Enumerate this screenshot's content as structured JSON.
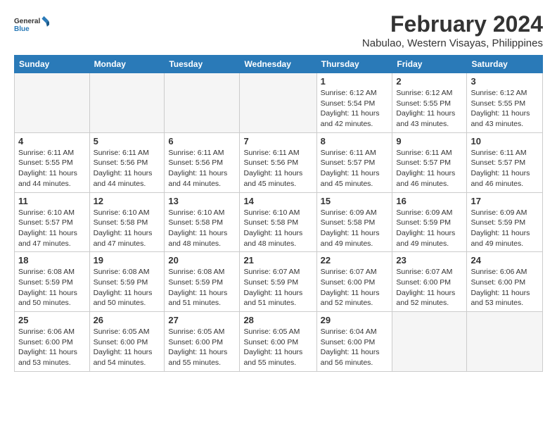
{
  "logo": {
    "text_general": "General",
    "text_blue": "Blue"
  },
  "title": "February 2024",
  "subtitle": "Nabulao, Western Visayas, Philippines",
  "days_of_week": [
    "Sunday",
    "Monday",
    "Tuesday",
    "Wednesday",
    "Thursday",
    "Friday",
    "Saturday"
  ],
  "weeks": [
    [
      {
        "day": "",
        "info": ""
      },
      {
        "day": "",
        "info": ""
      },
      {
        "day": "",
        "info": ""
      },
      {
        "day": "",
        "info": ""
      },
      {
        "day": "1",
        "info": "Sunrise: 6:12 AM\nSunset: 5:54 PM\nDaylight: 11 hours\nand 42 minutes."
      },
      {
        "day": "2",
        "info": "Sunrise: 6:12 AM\nSunset: 5:55 PM\nDaylight: 11 hours\nand 43 minutes."
      },
      {
        "day": "3",
        "info": "Sunrise: 6:12 AM\nSunset: 5:55 PM\nDaylight: 11 hours\nand 43 minutes."
      }
    ],
    [
      {
        "day": "4",
        "info": "Sunrise: 6:11 AM\nSunset: 5:55 PM\nDaylight: 11 hours\nand 44 minutes."
      },
      {
        "day": "5",
        "info": "Sunrise: 6:11 AM\nSunset: 5:56 PM\nDaylight: 11 hours\nand 44 minutes."
      },
      {
        "day": "6",
        "info": "Sunrise: 6:11 AM\nSunset: 5:56 PM\nDaylight: 11 hours\nand 44 minutes."
      },
      {
        "day": "7",
        "info": "Sunrise: 6:11 AM\nSunset: 5:56 PM\nDaylight: 11 hours\nand 45 minutes."
      },
      {
        "day": "8",
        "info": "Sunrise: 6:11 AM\nSunset: 5:57 PM\nDaylight: 11 hours\nand 45 minutes."
      },
      {
        "day": "9",
        "info": "Sunrise: 6:11 AM\nSunset: 5:57 PM\nDaylight: 11 hours\nand 46 minutes."
      },
      {
        "day": "10",
        "info": "Sunrise: 6:11 AM\nSunset: 5:57 PM\nDaylight: 11 hours\nand 46 minutes."
      }
    ],
    [
      {
        "day": "11",
        "info": "Sunrise: 6:10 AM\nSunset: 5:57 PM\nDaylight: 11 hours\nand 47 minutes."
      },
      {
        "day": "12",
        "info": "Sunrise: 6:10 AM\nSunset: 5:58 PM\nDaylight: 11 hours\nand 47 minutes."
      },
      {
        "day": "13",
        "info": "Sunrise: 6:10 AM\nSunset: 5:58 PM\nDaylight: 11 hours\nand 48 minutes."
      },
      {
        "day": "14",
        "info": "Sunrise: 6:10 AM\nSunset: 5:58 PM\nDaylight: 11 hours\nand 48 minutes."
      },
      {
        "day": "15",
        "info": "Sunrise: 6:09 AM\nSunset: 5:58 PM\nDaylight: 11 hours\nand 49 minutes."
      },
      {
        "day": "16",
        "info": "Sunrise: 6:09 AM\nSunset: 5:59 PM\nDaylight: 11 hours\nand 49 minutes."
      },
      {
        "day": "17",
        "info": "Sunrise: 6:09 AM\nSunset: 5:59 PM\nDaylight: 11 hours\nand 49 minutes."
      }
    ],
    [
      {
        "day": "18",
        "info": "Sunrise: 6:08 AM\nSunset: 5:59 PM\nDaylight: 11 hours\nand 50 minutes."
      },
      {
        "day": "19",
        "info": "Sunrise: 6:08 AM\nSunset: 5:59 PM\nDaylight: 11 hours\nand 50 minutes."
      },
      {
        "day": "20",
        "info": "Sunrise: 6:08 AM\nSunset: 5:59 PM\nDaylight: 11 hours\nand 51 minutes."
      },
      {
        "day": "21",
        "info": "Sunrise: 6:07 AM\nSunset: 5:59 PM\nDaylight: 11 hours\nand 51 minutes."
      },
      {
        "day": "22",
        "info": "Sunrise: 6:07 AM\nSunset: 6:00 PM\nDaylight: 11 hours\nand 52 minutes."
      },
      {
        "day": "23",
        "info": "Sunrise: 6:07 AM\nSunset: 6:00 PM\nDaylight: 11 hours\nand 52 minutes."
      },
      {
        "day": "24",
        "info": "Sunrise: 6:06 AM\nSunset: 6:00 PM\nDaylight: 11 hours\nand 53 minutes."
      }
    ],
    [
      {
        "day": "25",
        "info": "Sunrise: 6:06 AM\nSunset: 6:00 PM\nDaylight: 11 hours\nand 53 minutes."
      },
      {
        "day": "26",
        "info": "Sunrise: 6:05 AM\nSunset: 6:00 PM\nDaylight: 11 hours\nand 54 minutes."
      },
      {
        "day": "27",
        "info": "Sunrise: 6:05 AM\nSunset: 6:00 PM\nDaylight: 11 hours\nand 55 minutes."
      },
      {
        "day": "28",
        "info": "Sunrise: 6:05 AM\nSunset: 6:00 PM\nDaylight: 11 hours\nand 55 minutes."
      },
      {
        "day": "29",
        "info": "Sunrise: 6:04 AM\nSunset: 6:00 PM\nDaylight: 11 hours\nand 56 minutes."
      },
      {
        "day": "",
        "info": ""
      },
      {
        "day": "",
        "info": ""
      }
    ]
  ]
}
